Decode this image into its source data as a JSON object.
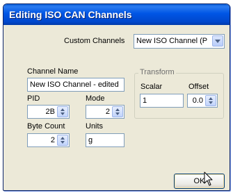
{
  "window": {
    "title": "Editing ISO CAN Channels"
  },
  "custom_channels": {
    "label": "Custom Channels",
    "value": "New ISO Channel (P"
  },
  "channel_name": {
    "label": "Channel Name",
    "value": "New ISO Channel - edited"
  },
  "pid": {
    "label": "PID",
    "value": "2B"
  },
  "mode": {
    "label": "Mode",
    "value": "2"
  },
  "byte_count": {
    "label": "Byte Count",
    "value": "2"
  },
  "units": {
    "label": "Units",
    "value": "g"
  },
  "transform": {
    "title": "Transform",
    "scalar_label": "Scalar",
    "scalar_value": "1",
    "offset_label": "Offset",
    "offset_value": "0.0"
  },
  "ok_button": {
    "label": "OK"
  },
  "icons": {
    "cursor": "mouse-pointer-icon",
    "spin": "up-down-arrows-icon",
    "dropdown": "chevron-down-icon"
  }
}
